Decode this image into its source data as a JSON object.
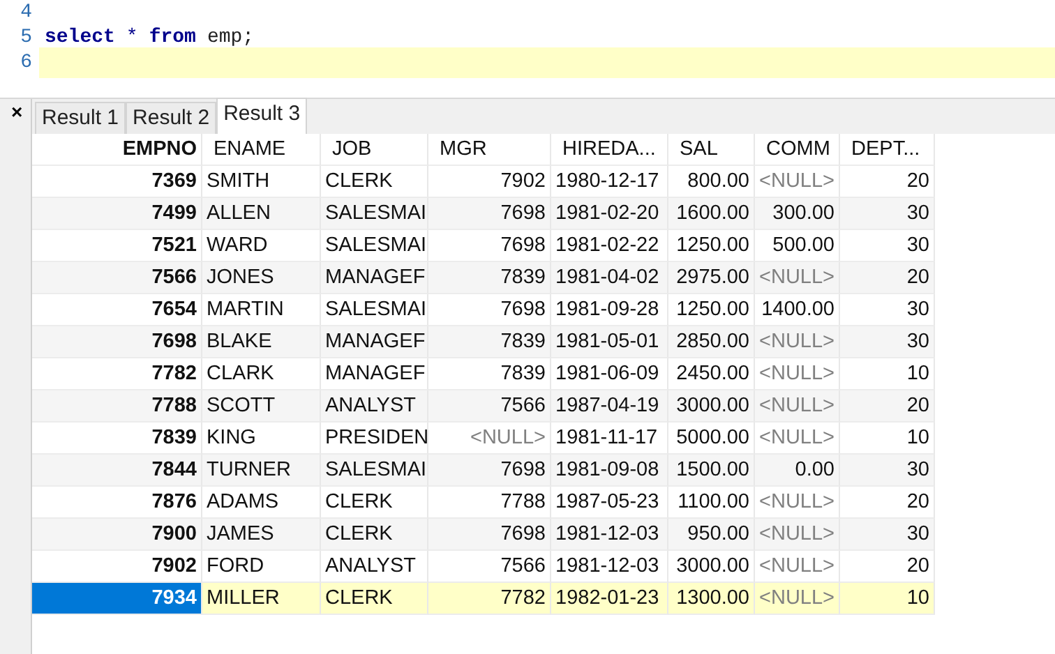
{
  "editor": {
    "lines": [
      {
        "number": "4",
        "current": false
      },
      {
        "number": "5",
        "current": false,
        "tokens": [
          {
            "text": "select",
            "kind": "keyword"
          },
          {
            "text": "*",
            "kind": "operator"
          },
          {
            "text": "from",
            "kind": "keyword"
          },
          {
            "text": "emp;",
            "kind": "plain"
          }
        ]
      },
      {
        "number": "6",
        "current": true
      }
    ]
  },
  "results": {
    "close": "×",
    "tabs": [
      {
        "label": "Result 1",
        "selected": false
      },
      {
        "label": "Result 2",
        "selected": false
      },
      {
        "label": "Result 3",
        "selected": true
      }
    ],
    "columns": [
      {
        "label": "EMPNO",
        "kind": "key"
      },
      {
        "label": "ENAME",
        "kind": "text"
      },
      {
        "label": "JOB",
        "kind": "text"
      },
      {
        "label": "MGR",
        "kind": "number"
      },
      {
        "label": "HIREDA...",
        "kind": "text"
      },
      {
        "label": "SAL",
        "kind": "number"
      },
      {
        "label": "COMM",
        "kind": "number"
      },
      {
        "label": "DEPT...",
        "kind": "number"
      }
    ],
    "rows": [
      {
        "selected": false,
        "cells": [
          {
            "text": "7369",
            "is_null": false
          },
          {
            "text": "SMITH",
            "is_null": false
          },
          {
            "text": "CLERK",
            "is_null": false
          },
          {
            "text": "7902",
            "is_null": false
          },
          {
            "text": "1980-12-17",
            "is_null": false
          },
          {
            "text": "800.00",
            "is_null": false
          },
          {
            "text": "<NULL>",
            "is_null": true
          },
          {
            "text": "20",
            "is_null": false
          }
        ]
      },
      {
        "selected": false,
        "cells": [
          {
            "text": "7499",
            "is_null": false
          },
          {
            "text": "ALLEN",
            "is_null": false
          },
          {
            "text": "SALESMAI",
            "is_null": false
          },
          {
            "text": "7698",
            "is_null": false
          },
          {
            "text": "1981-02-20",
            "is_null": false
          },
          {
            "text": "1600.00",
            "is_null": false
          },
          {
            "text": "300.00",
            "is_null": false
          },
          {
            "text": "30",
            "is_null": false
          }
        ]
      },
      {
        "selected": false,
        "cells": [
          {
            "text": "7521",
            "is_null": false
          },
          {
            "text": "WARD",
            "is_null": false
          },
          {
            "text": "SALESMAI",
            "is_null": false
          },
          {
            "text": "7698",
            "is_null": false
          },
          {
            "text": "1981-02-22",
            "is_null": false
          },
          {
            "text": "1250.00",
            "is_null": false
          },
          {
            "text": "500.00",
            "is_null": false
          },
          {
            "text": "30",
            "is_null": false
          }
        ]
      },
      {
        "selected": false,
        "cells": [
          {
            "text": "7566",
            "is_null": false
          },
          {
            "text": "JONES",
            "is_null": false
          },
          {
            "text": "MANAGEF",
            "is_null": false
          },
          {
            "text": "7839",
            "is_null": false
          },
          {
            "text": "1981-04-02",
            "is_null": false
          },
          {
            "text": "2975.00",
            "is_null": false
          },
          {
            "text": "<NULL>",
            "is_null": true
          },
          {
            "text": "20",
            "is_null": false
          }
        ]
      },
      {
        "selected": false,
        "cells": [
          {
            "text": "7654",
            "is_null": false
          },
          {
            "text": "MARTIN",
            "is_null": false
          },
          {
            "text": "SALESMAI",
            "is_null": false
          },
          {
            "text": "7698",
            "is_null": false
          },
          {
            "text": "1981-09-28",
            "is_null": false
          },
          {
            "text": "1250.00",
            "is_null": false
          },
          {
            "text": "1400.00",
            "is_null": false
          },
          {
            "text": "30",
            "is_null": false
          }
        ]
      },
      {
        "selected": false,
        "cells": [
          {
            "text": "7698",
            "is_null": false
          },
          {
            "text": "BLAKE",
            "is_null": false
          },
          {
            "text": "MANAGEF",
            "is_null": false
          },
          {
            "text": "7839",
            "is_null": false
          },
          {
            "text": "1981-05-01",
            "is_null": false
          },
          {
            "text": "2850.00",
            "is_null": false
          },
          {
            "text": "<NULL>",
            "is_null": true
          },
          {
            "text": "30",
            "is_null": false
          }
        ]
      },
      {
        "selected": false,
        "cells": [
          {
            "text": "7782",
            "is_null": false
          },
          {
            "text": "CLARK",
            "is_null": false
          },
          {
            "text": "MANAGEF",
            "is_null": false
          },
          {
            "text": "7839",
            "is_null": false
          },
          {
            "text": "1981-06-09",
            "is_null": false
          },
          {
            "text": "2450.00",
            "is_null": false
          },
          {
            "text": "<NULL>",
            "is_null": true
          },
          {
            "text": "10",
            "is_null": false
          }
        ]
      },
      {
        "selected": false,
        "cells": [
          {
            "text": "7788",
            "is_null": false
          },
          {
            "text": "SCOTT",
            "is_null": false
          },
          {
            "text": "ANALYST",
            "is_null": false
          },
          {
            "text": "7566",
            "is_null": false
          },
          {
            "text": "1987-04-19",
            "is_null": false
          },
          {
            "text": "3000.00",
            "is_null": false
          },
          {
            "text": "<NULL>",
            "is_null": true
          },
          {
            "text": "20",
            "is_null": false
          }
        ]
      },
      {
        "selected": false,
        "cells": [
          {
            "text": "7839",
            "is_null": false
          },
          {
            "text": "KING",
            "is_null": false
          },
          {
            "text": "PRESIDEN",
            "is_null": false
          },
          {
            "text": "<NULL>",
            "is_null": true
          },
          {
            "text": "1981-11-17",
            "is_null": false
          },
          {
            "text": "5000.00",
            "is_null": false
          },
          {
            "text": "<NULL>",
            "is_null": true
          },
          {
            "text": "10",
            "is_null": false
          }
        ]
      },
      {
        "selected": false,
        "cells": [
          {
            "text": "7844",
            "is_null": false
          },
          {
            "text": "TURNER",
            "is_null": false
          },
          {
            "text": "SALESMAI",
            "is_null": false
          },
          {
            "text": "7698",
            "is_null": false
          },
          {
            "text": "1981-09-08",
            "is_null": false
          },
          {
            "text": "1500.00",
            "is_null": false
          },
          {
            "text": "0.00",
            "is_null": false
          },
          {
            "text": "30",
            "is_null": false
          }
        ]
      },
      {
        "selected": false,
        "cells": [
          {
            "text": "7876",
            "is_null": false
          },
          {
            "text": "ADAMS",
            "is_null": false
          },
          {
            "text": "CLERK",
            "is_null": false
          },
          {
            "text": "7788",
            "is_null": false
          },
          {
            "text": "1987-05-23",
            "is_null": false
          },
          {
            "text": "1100.00",
            "is_null": false
          },
          {
            "text": "<NULL>",
            "is_null": true
          },
          {
            "text": "20",
            "is_null": false
          }
        ]
      },
      {
        "selected": false,
        "cells": [
          {
            "text": "7900",
            "is_null": false
          },
          {
            "text": "JAMES",
            "is_null": false
          },
          {
            "text": "CLERK",
            "is_null": false
          },
          {
            "text": "7698",
            "is_null": false
          },
          {
            "text": "1981-12-03",
            "is_null": false
          },
          {
            "text": "950.00",
            "is_null": false
          },
          {
            "text": "<NULL>",
            "is_null": true
          },
          {
            "text": "30",
            "is_null": false
          }
        ]
      },
      {
        "selected": false,
        "cells": [
          {
            "text": "7902",
            "is_null": false
          },
          {
            "text": "FORD",
            "is_null": false
          },
          {
            "text": "ANALYST",
            "is_null": false
          },
          {
            "text": "7566",
            "is_null": false
          },
          {
            "text": "1981-12-03",
            "is_null": false
          },
          {
            "text": "3000.00",
            "is_null": false
          },
          {
            "text": "<NULL>",
            "is_null": true
          },
          {
            "text": "20",
            "is_null": false
          }
        ]
      },
      {
        "selected": true,
        "cells": [
          {
            "text": "7934",
            "is_null": false
          },
          {
            "text": "MILLER",
            "is_null": false
          },
          {
            "text": "CLERK",
            "is_null": false
          },
          {
            "text": "7782",
            "is_null": false
          },
          {
            "text": "1982-01-23",
            "is_null": false
          },
          {
            "text": "1300.00",
            "is_null": false
          },
          {
            "text": "<NULL>",
            "is_null": true
          },
          {
            "text": "10",
            "is_null": false
          }
        ]
      }
    ]
  }
}
